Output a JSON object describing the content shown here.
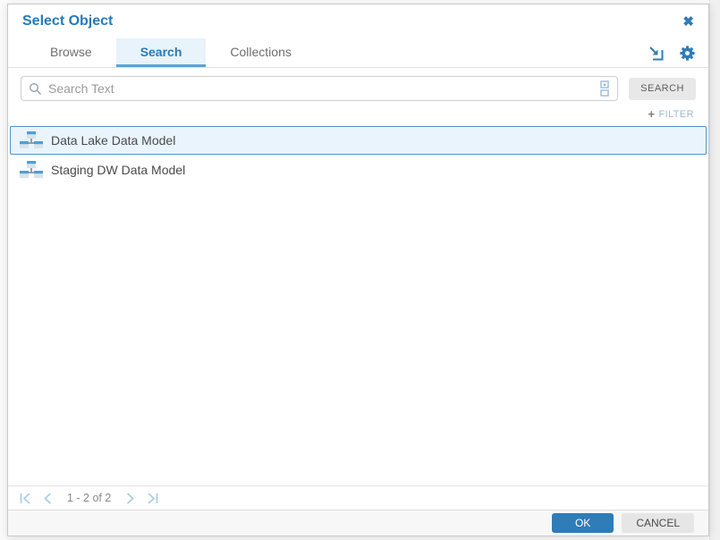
{
  "dialog": {
    "title": "Select Object",
    "close_glyph": "✖"
  },
  "tabs": [
    {
      "label": "Browse",
      "active": false
    },
    {
      "label": "Search",
      "active": true
    },
    {
      "label": "Collections",
      "active": false
    }
  ],
  "header_icons": [
    {
      "name": "export-icon"
    },
    {
      "name": "settings-gear-icon"
    }
  ],
  "search": {
    "placeholder": "Search Text",
    "value": "",
    "button_label": "SEARCH"
  },
  "filter": {
    "plus_glyph": "+",
    "label": "FILTER"
  },
  "list": {
    "items": [
      {
        "label": "Data Lake Data Model",
        "selected": true,
        "icon": "data-model-icon"
      },
      {
        "label": "Staging DW Data Model",
        "selected": false,
        "icon": "data-model-icon"
      }
    ]
  },
  "pagination": {
    "range_text": "1 - 2 of 2"
  },
  "footer": {
    "ok_label": "OK",
    "cancel_label": "CANCEL"
  },
  "colors": {
    "accent_blue": "#2e7cb8",
    "title_blue": "#2879b9",
    "tab_active_bg": "#e8f3fb",
    "tab_underline": "#57a4d9",
    "selected_row_bg": "#e9f4fd",
    "selected_row_border": "#4e94c8",
    "pagination_arrow": "#a9cee9",
    "footer_bg": "#f7f7f7"
  }
}
